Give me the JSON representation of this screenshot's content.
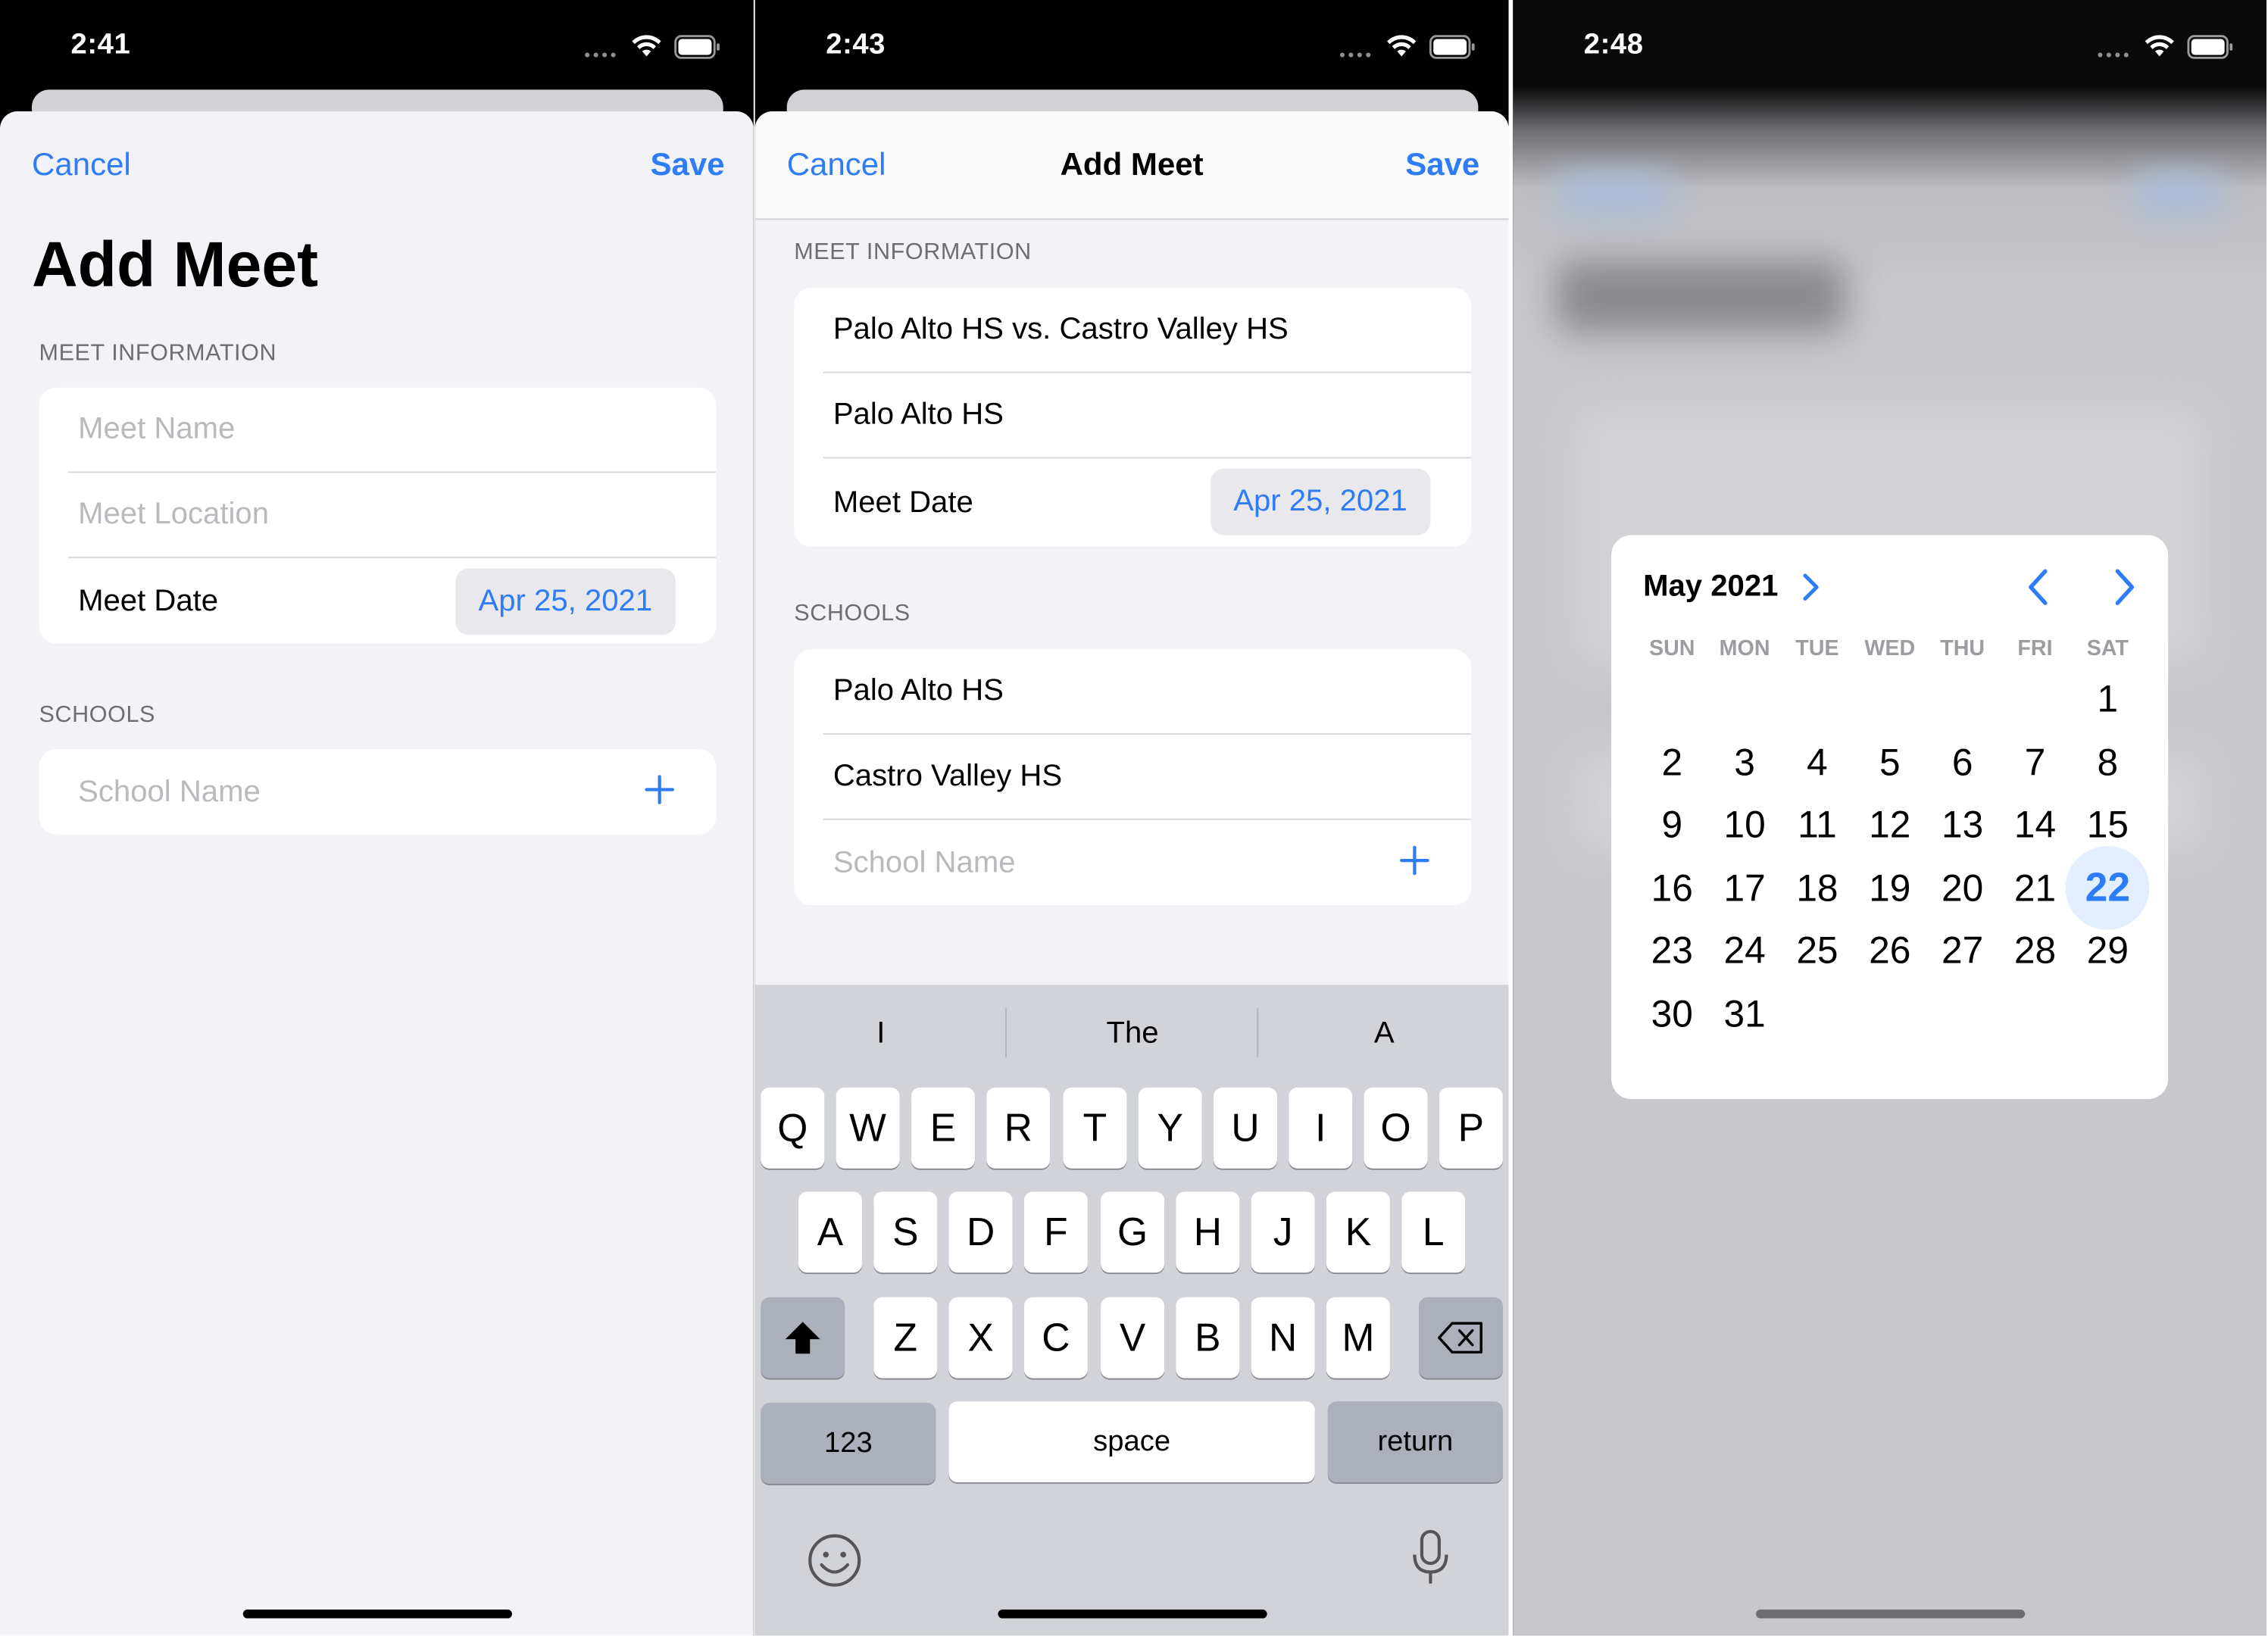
{
  "accent_color": "#2e7cf6",
  "panel1": {
    "time": "2:41",
    "cancel": "Cancel",
    "save": "Save",
    "title": "Add Meet",
    "section_meet": "MEET INFORMATION",
    "meet_name_placeholder": "Meet Name",
    "meet_location_placeholder": "Meet Location",
    "meet_date_label": "Meet Date",
    "meet_date_value": "Apr 25, 2021",
    "section_schools": "SCHOOLS",
    "school_name_placeholder": "School Name"
  },
  "panel2": {
    "time": "2:43",
    "cancel": "Cancel",
    "title": "Add Meet",
    "save": "Save",
    "section_meet": "MEET INFORMATION",
    "meet_name": "Palo Alto HS vs. Castro Valley HS",
    "meet_location": "Palo Alto HS",
    "meet_date_label": "Meet Date",
    "meet_date_value": "Apr 25, 2021",
    "section_schools": "SCHOOLS",
    "schools": [
      "Palo Alto HS",
      "Castro Valley HS"
    ],
    "school_name_placeholder": "School Name",
    "keyboard": {
      "suggestions": [
        "I",
        "The",
        "A"
      ],
      "row1": [
        "Q",
        "W",
        "E",
        "R",
        "T",
        "Y",
        "U",
        "I",
        "O",
        "P"
      ],
      "row2": [
        "A",
        "S",
        "D",
        "F",
        "G",
        "H",
        "J",
        "K",
        "L"
      ],
      "row3": [
        "Z",
        "X",
        "C",
        "V",
        "B",
        "N",
        "M"
      ],
      "numbers": "123",
      "space": "space",
      "return": "return"
    }
  },
  "panel3": {
    "time": "2:48",
    "calendar": {
      "month": "May 2021",
      "weekdays": [
        "SUN",
        "MON",
        "TUE",
        "WED",
        "THU",
        "FRI",
        "SAT"
      ],
      "first_weekday_index": 6,
      "days_in_month": 31,
      "selected_day": 22
    }
  }
}
